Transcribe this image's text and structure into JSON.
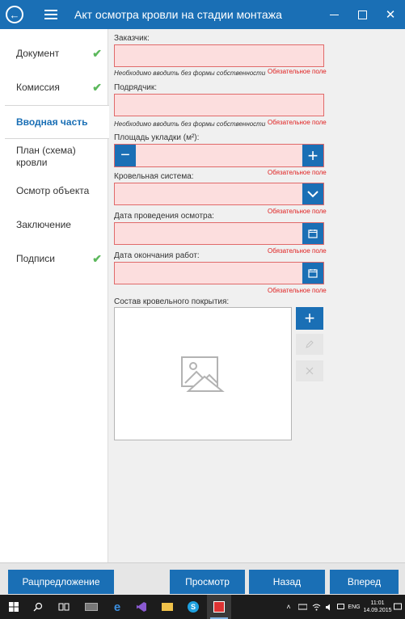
{
  "window": {
    "title": "Акт осмотра кровли на стадии монтажа",
    "back_icon": "back-arrow-icon",
    "menu_icon": "hamburger-icon",
    "accent_color": "#1a6fb5"
  },
  "sidebar": {
    "items": [
      {
        "label": "Документ",
        "checked": true
      },
      {
        "label": "Комиссия",
        "checked": true
      },
      {
        "label": "Вводная часть",
        "checked": false,
        "active": true
      },
      {
        "label": "План (схема) кровли",
        "checked": false
      },
      {
        "label": "Осмотр объекта",
        "checked": false
      },
      {
        "label": "Заключение",
        "checked": false
      },
      {
        "label": "Подписи",
        "checked": true
      }
    ],
    "check_glyph": "✔"
  },
  "form": {
    "customer": {
      "label": "Заказчик:",
      "value": "",
      "hint": "Необходимо вводить без формы собственности",
      "required": "Обязательное поле"
    },
    "contractor": {
      "label": "Подрядчик:",
      "value": "",
      "hint": "Необходимо вводить без формы собственности",
      "required": "Обязательное поле"
    },
    "area": {
      "label": "Площадь укладки (м²):",
      "value": "",
      "minus": "−",
      "plus": "+",
      "required": "Обязательное поле"
    },
    "roof_system": {
      "label": "Кровельная система:",
      "value": "",
      "required": "Обязательное поле"
    },
    "inspection_date": {
      "label": "Дата проведения осмотра:",
      "value": "",
      "required": "Обязательное поле"
    },
    "work_end_date": {
      "label": "Дата окончания работ:",
      "value": "",
      "required": "Обязательное поле"
    },
    "composition": {
      "label": "Состав кровельного покрытия:",
      "add": "+"
    }
  },
  "buttons": {
    "reject": "Рацпредложение",
    "preview": "Просмотр",
    "back": "Назад",
    "forward": "Вперед"
  },
  "taskbar": {
    "lang": "ENG",
    "time": "11:01",
    "date": "14.09.2015"
  }
}
